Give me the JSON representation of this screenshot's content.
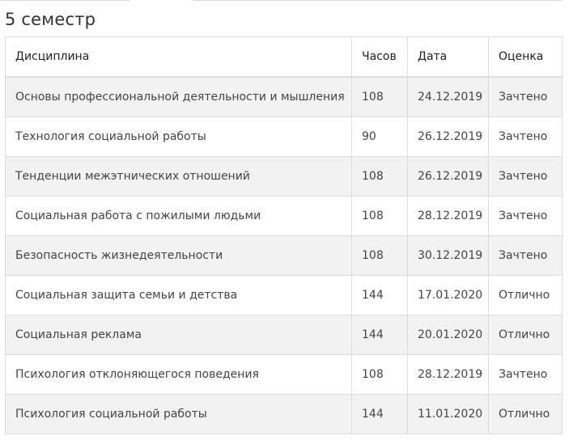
{
  "semester": {
    "title": "5 семестр"
  },
  "table": {
    "headers": {
      "discipline": "Дисциплина",
      "hours": "Часов",
      "date": "Дата",
      "grade": "Оценка"
    },
    "rows": [
      {
        "discipline": "Основы профессиональной деятельности и мышления",
        "hours": "108",
        "date": "24.12.2019",
        "grade": "Зачтено"
      },
      {
        "discipline": "Технология социальной работы",
        "hours": "90",
        "date": "26.12.2019",
        "grade": "Зачтено"
      },
      {
        "discipline": "Тенденции межэтнических отношений",
        "hours": "108",
        "date": "26.12.2019",
        "grade": "Зачтено"
      },
      {
        "discipline": "Социальная работа с пожилыми людьми",
        "hours": "108",
        "date": "28.12.2019",
        "grade": "Зачтено"
      },
      {
        "discipline": "Безопасность жизнедеятельности",
        "hours": "108",
        "date": "30.12.2019",
        "grade": "Зачтено"
      },
      {
        "discipline": "Социальная защита семьи и детства",
        "hours": "144",
        "date": "17.01.2020",
        "grade": "Отлично"
      },
      {
        "discipline": "Социальная реклама",
        "hours": "144",
        "date": "20.01.2020",
        "grade": "Отлично"
      },
      {
        "discipline": "Психология отклоняющегося поведения",
        "hours": "108",
        "date": "28.12.2019",
        "grade": "Зачтено"
      },
      {
        "discipline": "Психология социальной работы",
        "hours": "144",
        "date": "11.01.2020",
        "grade": "Отлично"
      }
    ]
  }
}
